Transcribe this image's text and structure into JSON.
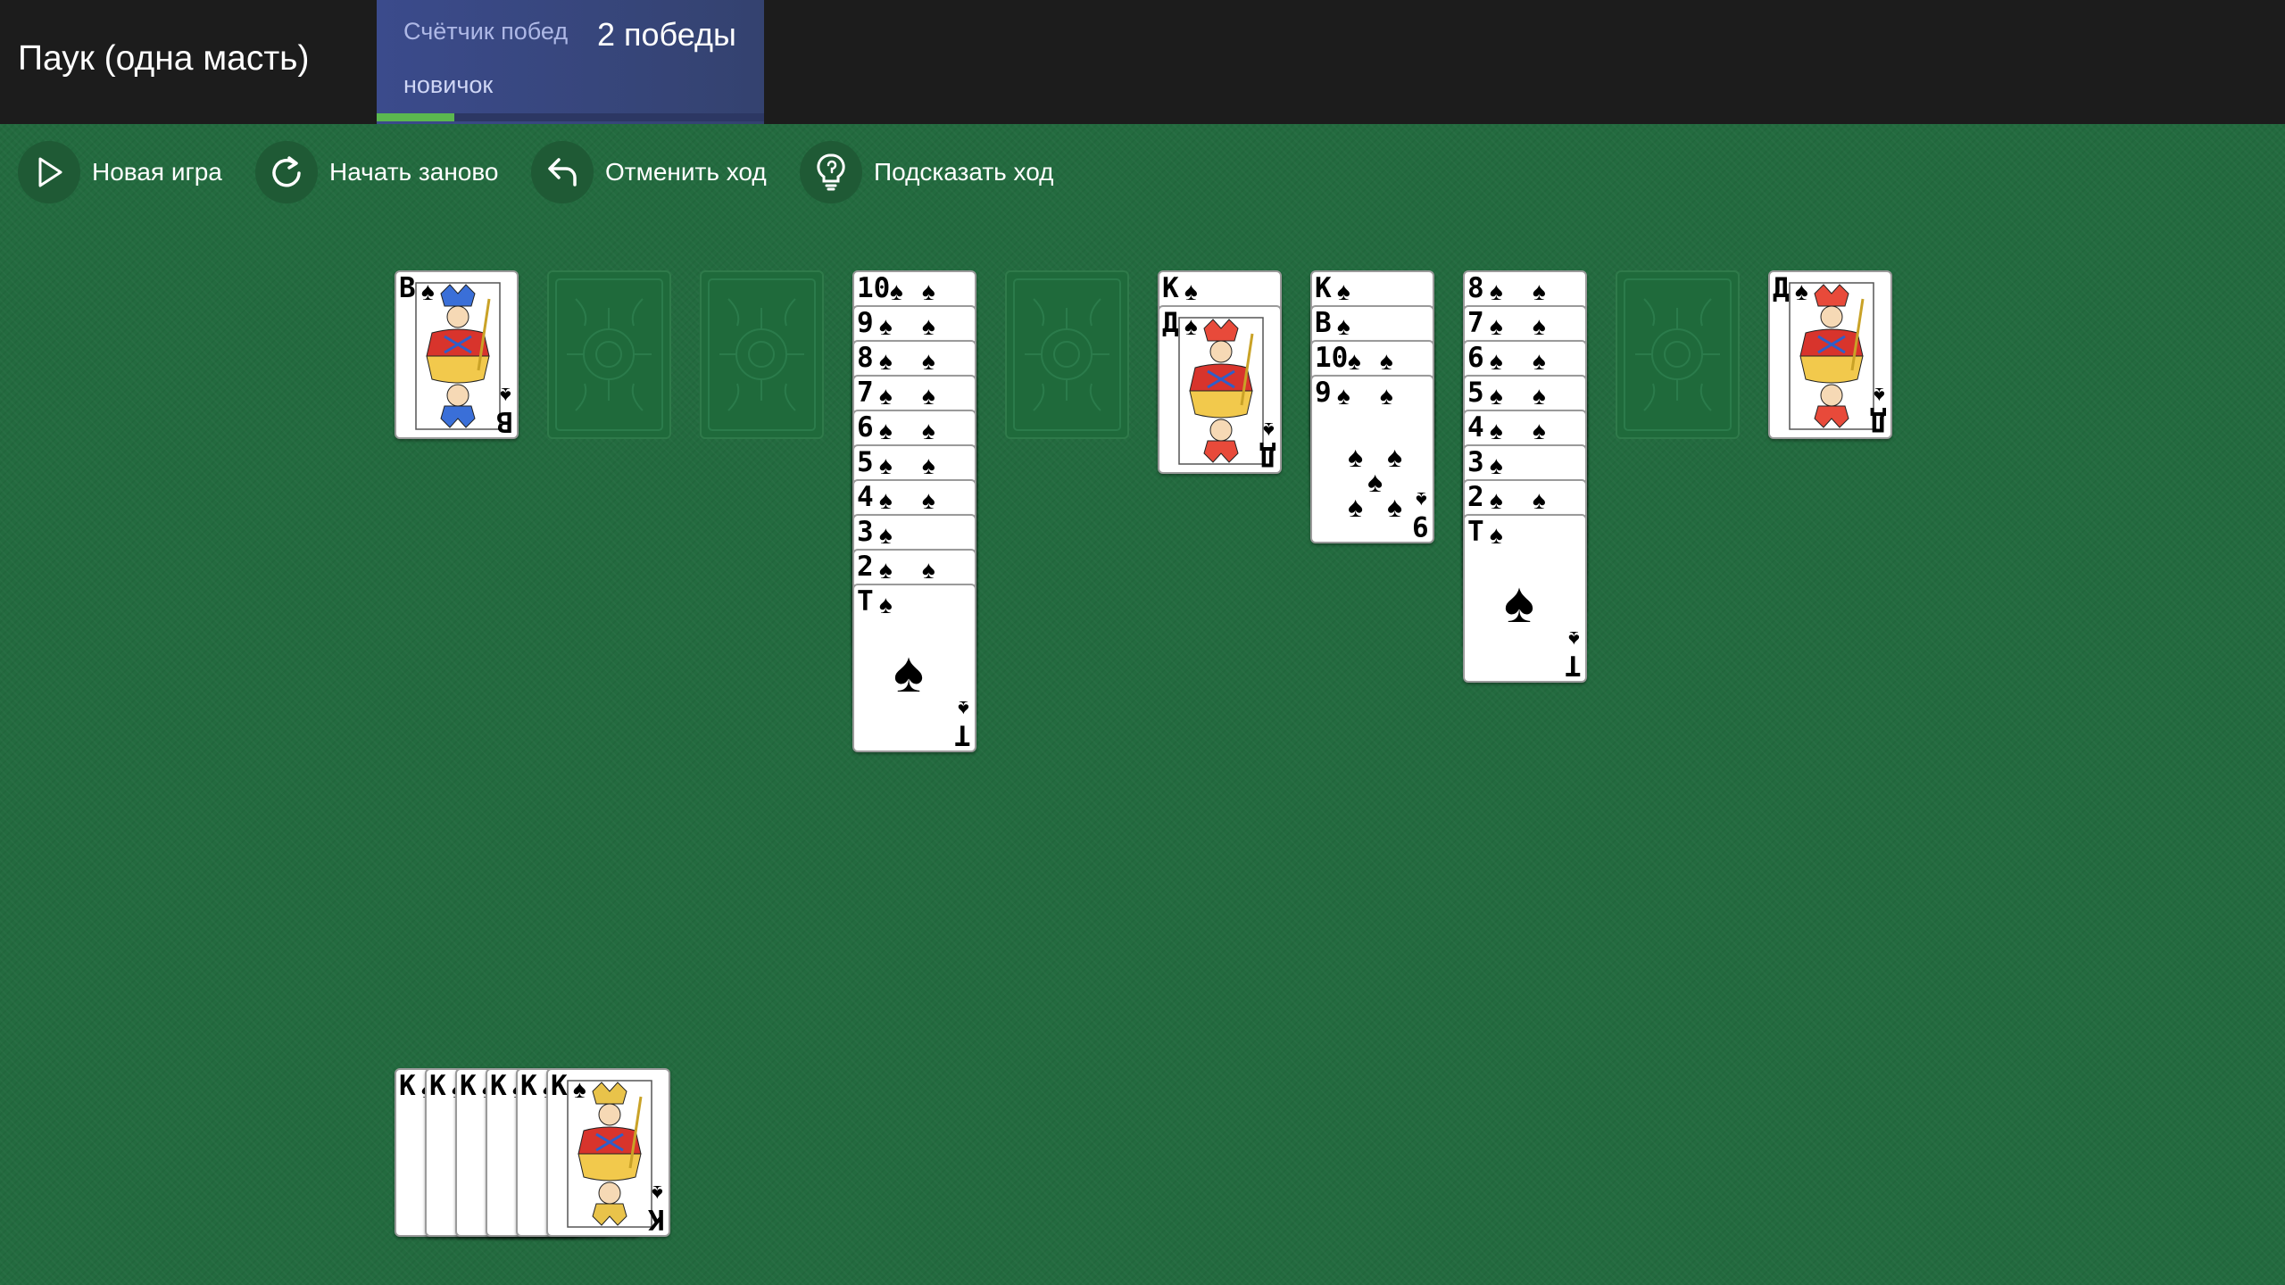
{
  "header": {
    "title": "Паук (одна масть)",
    "wins": {
      "label": "Счётчик побед",
      "value": "2 победы",
      "rank": "новичок",
      "rank_progress": 0.2
    }
  },
  "toolbar": {
    "new_game": "Новая игра",
    "restart": "Начать заново",
    "undo": "Отменить ход",
    "hint": "Подсказать ход"
  },
  "colors": {
    "topbar": "#1c1c1c",
    "felt": "#236b3f",
    "wins_panel": "#3b4b8c",
    "rank_fill": "#5bb84f"
  },
  "tableau": [
    {
      "cards": [
        "В"
      ]
    },
    {
      "cards": []
    },
    {
      "cards": []
    },
    {
      "cards": [
        "10",
        "9",
        "8",
        "7",
        "6",
        "5",
        "4",
        "3",
        "2",
        "Т"
      ]
    },
    {
      "cards": []
    },
    {
      "cards": [
        "К",
        "Д"
      ]
    },
    {
      "cards": [
        "К",
        "В",
        "10",
        "9"
      ]
    },
    {
      "cards": [
        "8",
        "7",
        "6",
        "5",
        "4",
        "3",
        "2",
        "Т"
      ]
    },
    {
      "cards": []
    },
    {
      "cards": [
        "Д"
      ]
    }
  ],
  "completed": {
    "cards": [
      "К",
      "К",
      "К",
      "К",
      "К",
      "К"
    ]
  },
  "suit_symbol": "♠"
}
